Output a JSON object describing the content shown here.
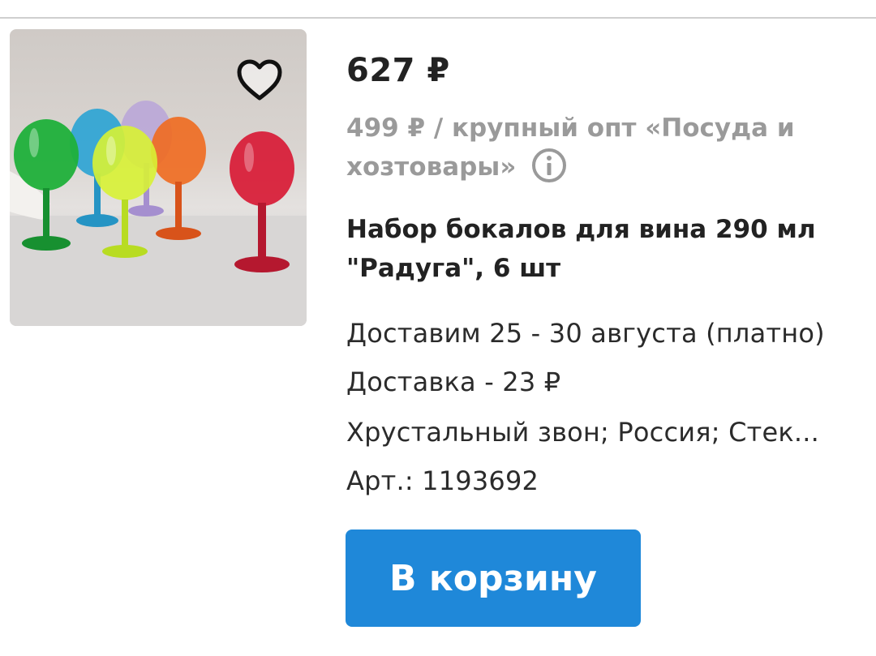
{
  "product": {
    "price": "627 ₽",
    "wholesale_price_text": "499 ₽ / крупный опт «Посуда и хозтовары»",
    "title": "Набор бокалов для вина 290 мл \"Радуга\", 6 шт",
    "delivery_dates": "Доставим 25 - 30 августа (платно)",
    "delivery_cost": "Доставка - 23 ₽",
    "attributes": "Хрустальный звон; Россия; Стек...",
    "article": "Арт.: 1193692"
  },
  "actions": {
    "add_to_cart_label": "В корзину",
    "favorite_icon": "heart-outline-icon",
    "info_icon": "info-circle-icon"
  },
  "colors": {
    "primary_button": "#1f88d9",
    "price_text": "#222222",
    "secondary_text": "#9a9a9a"
  }
}
